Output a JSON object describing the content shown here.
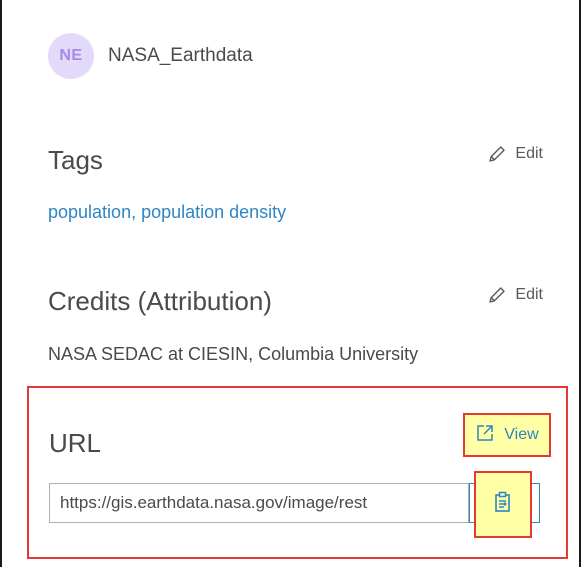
{
  "owner": {
    "initials": "NE",
    "name": "NASA_Earthdata"
  },
  "tags": {
    "title": "Tags",
    "edit_label": "Edit",
    "value": "population, population density"
  },
  "credits": {
    "title": "Credits (Attribution)",
    "edit_label": "Edit",
    "value": "NASA SEDAC at CIESIN, Columbia University"
  },
  "url": {
    "title": "URL",
    "view_label": "View",
    "value": "https://gis.earthdata.nasa.gov/image/rest"
  },
  "colors": {
    "link": "#2d86c4",
    "avatar_bg": "#e3d9f8",
    "avatar_text": "#a38ae8",
    "highlight_fill": "#ffffa6",
    "highlight_border": "#e53935"
  },
  "icons": {
    "edit": "pencil-icon",
    "view": "external-link-icon",
    "copy": "copy-clipboard-icon"
  }
}
